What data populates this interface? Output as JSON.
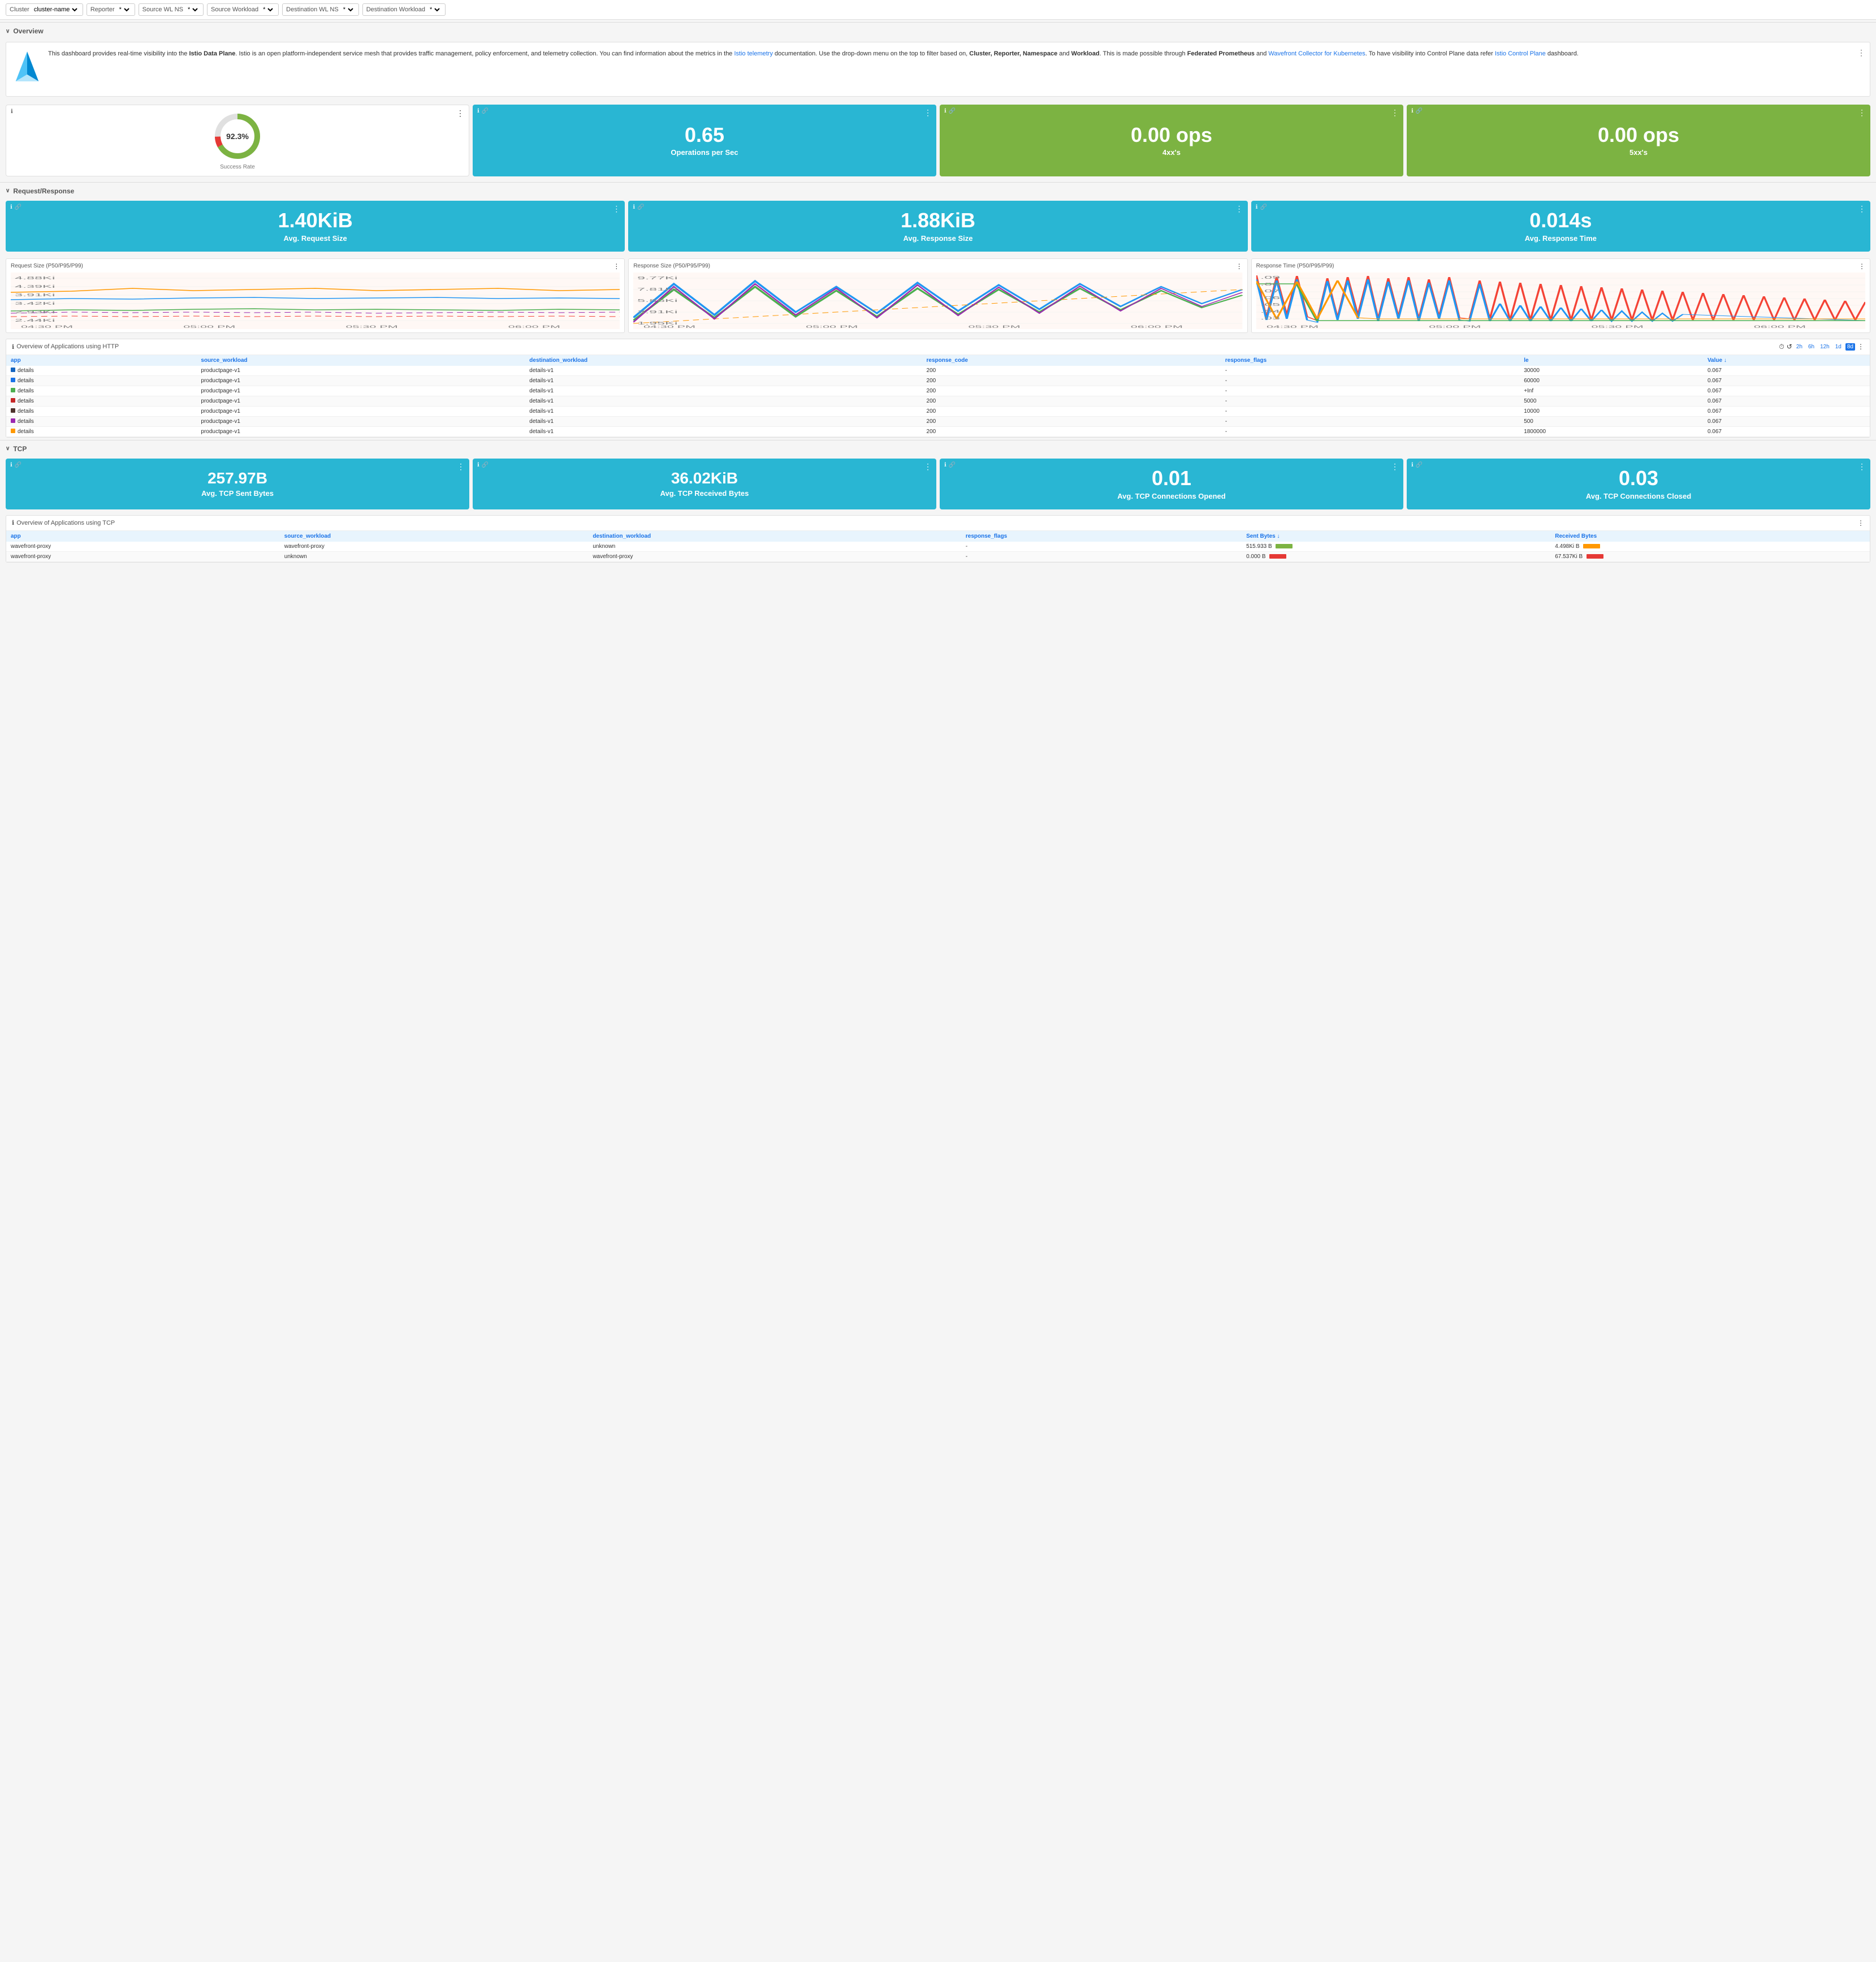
{
  "filterBar": {
    "cluster": {
      "label": "Cluster",
      "value": "cluster-name"
    },
    "reporter": {
      "label": "Reporter",
      "value": "*"
    },
    "sourceWlNs": {
      "label": "Source WL NS",
      "value": "*"
    },
    "sourceWorkload": {
      "label": "Source Workload",
      "value": "*"
    },
    "destWlNs": {
      "label": "Destination WL NS",
      "value": "*"
    },
    "destWorkload": {
      "label": "Destination Workload",
      "value": "*"
    }
  },
  "overview": {
    "sectionLabel": "Overview",
    "infoText1": "This dashboard provides real-time visibility into the ",
    "infoTextBold1": "Istio Data Plane",
    "infoText2": ". Istio is an open platform-independent service mesh that provides traffic management, policy enforcement, and telemetry collection. You can find information about the metrics in the ",
    "infoLink1": "Istio telemetry",
    "infoText3": " documentation. Use the drop-down menu on the top to filter based on, ",
    "infoTextBold2": "Cluster, Reporter, Namespace",
    "infoText4": " and ",
    "infoTextBold3": "Workload",
    "infoText5": ". This is made possible through ",
    "infoTextBold4": "Federated Prometheus",
    "infoText6": " and ",
    "infoLink2": "Wavefront Collector for Kubernetes",
    "infoText7": ". To have visibility into Control Plane data refer ",
    "infoLink3": "Istio Control Plane",
    "infoText8": " dashboard."
  },
  "successRate": {
    "value": "92.3%",
    "label": "Success Rate",
    "percentage": 92.3
  },
  "operationsPerSec": {
    "value": "0.65",
    "label": "Operations per Sec"
  },
  "ops4xx": {
    "value": "0.00 ops",
    "label": "4xx's"
  },
  "ops5xx": {
    "value": "0.00 ops",
    "label": "5xx's"
  },
  "requestResponse": {
    "sectionLabel": "Request/Response"
  },
  "avgRequestSize": {
    "value": "1.40KiB",
    "label": "Avg. Request Size"
  },
  "avgResponseSize": {
    "value": "1.88KiB",
    "label": "Avg. Response Size"
  },
  "avgResponseTime": {
    "value": "0.014s",
    "label": "Avg. Response Time"
  },
  "requestSizeChart": {
    "title": "Request Size (P50/P95/P99)",
    "yLabels": [
      "4.88Ki",
      "4.39Ki",
      "3.91Ki",
      "3.42Ki",
      "2.93Ki",
      "2.44Ki",
      "1.95Ki",
      "1.46Ki",
      ".977Ki"
    ],
    "xLabels": [
      "04:30 PM",
      "05:00 PM",
      "05:30 PM",
      "06:00 PM"
    ]
  },
  "responseSizeChart": {
    "title": "Response Size (P50/P95/P99)",
    "yLabels": [
      "9.77Ki",
      "7.81Ki",
      "5.86Ki",
      "3.91Ki",
      "1.95Ki"
    ],
    "xLabels": [
      "04:30 PM",
      "05:00 PM",
      "05:30 PM",
      "06:00 PM"
    ]
  },
  "responseTimeChart": {
    "title": "Response Time (P50/P95/P99)",
    "yLabels": [
      ".09",
      ".08",
      ".07",
      ".06",
      ".05",
      ".04",
      ".03",
      ".02",
      ".01"
    ],
    "xLabels": [
      "04:30 PM",
      "05:00 PM",
      "05:30 PM",
      "06:00 PM"
    ]
  },
  "httpTable": {
    "title": "Overview of Applications using HTTP",
    "timeControls": [
      "2h",
      "6h",
      "12h",
      "1d",
      "8d"
    ],
    "activeTime": "2h",
    "columns": [
      "app",
      "source_workload",
      "destination_workload",
      "response_code",
      "response_flags",
      "le",
      "Value"
    ],
    "rows": [
      {
        "color": "#1565c0",
        "app": "details",
        "source_workload": "productpage-v1",
        "destination_workload": "details-v1",
        "response_code": "200",
        "response_flags": "-",
        "le": "30000",
        "value": "0.067"
      },
      {
        "color": "#1a73e8",
        "app": "details",
        "source_workload": "productpage-v1",
        "destination_workload": "details-v1",
        "response_code": "200",
        "response_flags": "-",
        "le": "60000",
        "value": "0.067"
      },
      {
        "color": "#4caf50",
        "app": "details",
        "source_workload": "productpage-v1",
        "destination_workload": "details-v1",
        "response_code": "200",
        "response_flags": "-",
        "le": "+Inf",
        "value": "0.067"
      },
      {
        "color": "#c62828",
        "app": "details",
        "source_workload": "productpage-v1",
        "destination_workload": "details-v1",
        "response_code": "200",
        "response_flags": "-",
        "le": "5000",
        "value": "0.067"
      },
      {
        "color": "#4e342e",
        "app": "details",
        "source_workload": "productpage-v1",
        "destination_workload": "details-v1",
        "response_code": "200",
        "response_flags": "-",
        "le": "10000",
        "value": "0.067"
      },
      {
        "color": "#9c27b0",
        "app": "details",
        "source_workload": "productpage-v1",
        "destination_workload": "details-v1",
        "response_code": "200",
        "response_flags": "-",
        "le": "500",
        "value": "0.067"
      },
      {
        "color": "#ff9800",
        "app": "details",
        "source_workload": "productpage-v1",
        "destination_workload": "details-v1",
        "response_code": "200",
        "response_flags": "-",
        "le": "1800000",
        "value": "0.067"
      }
    ]
  },
  "tcp": {
    "sectionLabel": "TCP"
  },
  "avgTcpSent": {
    "value": "257.97B",
    "label": "Avg. TCP Sent Bytes"
  },
  "avgTcpReceived": {
    "value": "36.02KiB",
    "label": "Avg. TCP Received Bytes"
  },
  "avgTcpOpened": {
    "value": "0.01",
    "label": "Avg. TCP Connections Opened"
  },
  "avgTcpClosed": {
    "value": "0.03",
    "label": "Avg. TCP Connections Closed"
  },
  "tcpTable": {
    "title": "Overview of Applications using TCP",
    "columns": [
      "app",
      "source_workload",
      "destination_workload",
      "response_flags",
      "Sent Bytes",
      "Received Bytes"
    ],
    "rows": [
      {
        "app": "wavefront-proxy",
        "source_workload": "wavefront-proxy",
        "destination_workload": "unknown",
        "response_flags": "-",
        "sent_bytes": "515.933",
        "sent_unit": "B",
        "sent_color": "#7cb342",
        "received_bytes": "4.498Ki",
        "received_unit": "B",
        "received_color": "#ff9800"
      },
      {
        "app": "wavefront-proxy",
        "source_workload": "unknown",
        "destination_workload": "wavefront-proxy",
        "response_flags": "-",
        "sent_bytes": "0.000",
        "sent_unit": "B",
        "sent_color": "#e53935",
        "received_bytes": "67.537Ki",
        "received_unit": "B",
        "received_color": "#e53935"
      }
    ]
  },
  "icons": {
    "info": "ℹ",
    "link": "🔗",
    "kebab": "⋮",
    "chevronDown": "∨",
    "clock": "⏱",
    "refresh": "↺",
    "sortDesc": "↓"
  }
}
